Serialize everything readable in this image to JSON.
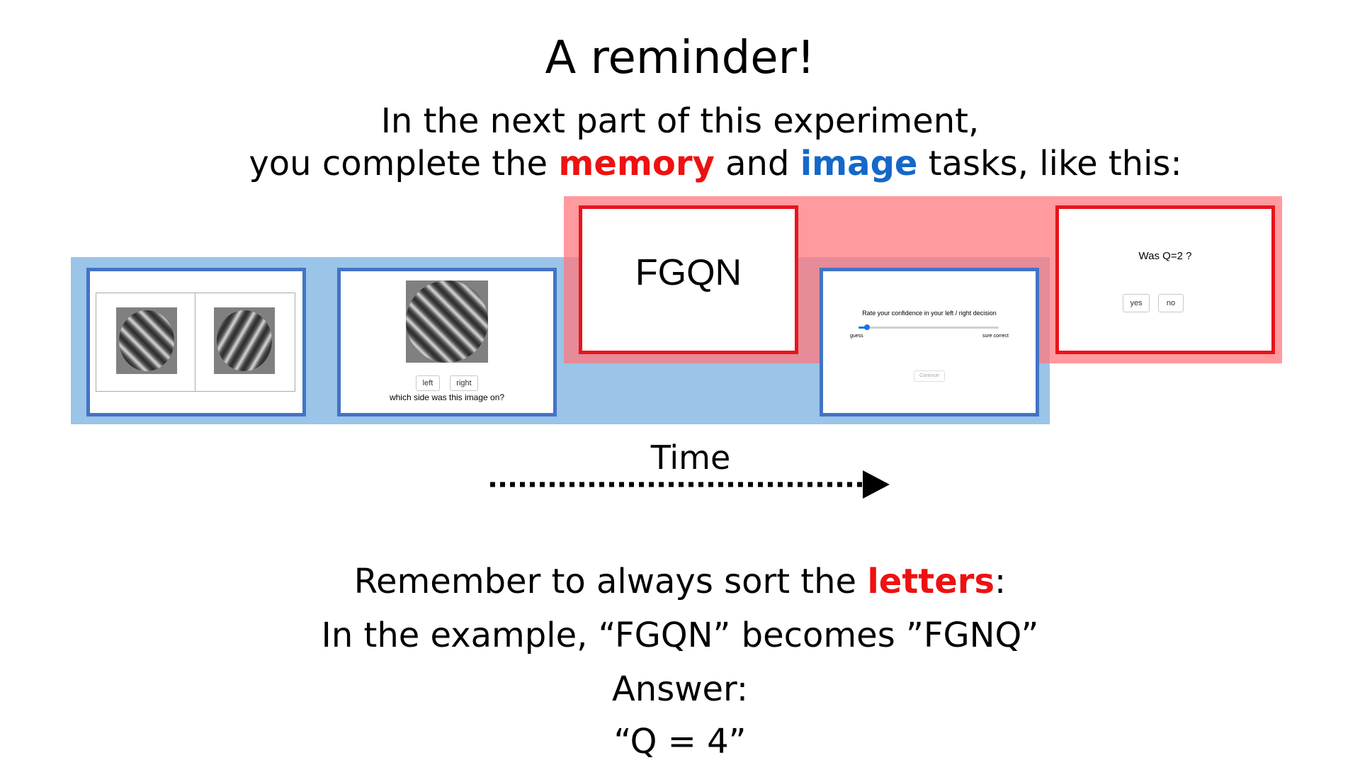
{
  "title": "A reminder!",
  "intro": {
    "line1": "In the next part of this experiment,",
    "line2_before": "you complete the ",
    "memory_word": "memory",
    "line2_middle": " and ",
    "image_word": "image",
    "line2_after": " tasks, like this:"
  },
  "panels": {
    "gratings": {
      "left_icon": "grating-stimulus",
      "right_icon": "grating-stimulus"
    },
    "side_question": {
      "left_button": "left",
      "right_button": "right",
      "question": "which side was this image on?"
    },
    "letters": {
      "text": "FGQN"
    },
    "confidence": {
      "prompt": "Rate your confidence in your left / right decision",
      "min_label": "guess",
      "max_label": "sure correct",
      "continue_button": "Continue",
      "slider_value": 0.06
    },
    "memory_probe": {
      "question": "Was Q=2 ?",
      "yes_button": "yes",
      "no_button": "no"
    }
  },
  "timeline": {
    "label": "Time"
  },
  "reminder": {
    "before": "Remember to always sort the ",
    "letters_word": "letters",
    "after": ":"
  },
  "example": {
    "text": "In the example, “FGQN” becomes ”FGNQ”"
  },
  "answer": {
    "label": "Answer:",
    "value": "“Q = 4”"
  },
  "colors": {
    "memory": "#ee1111",
    "image": "#1468c8",
    "blue_band": "#8fbee6",
    "red_band": "#ff787d",
    "blue_border": "#4473c5",
    "red_border": "#e8141c"
  }
}
